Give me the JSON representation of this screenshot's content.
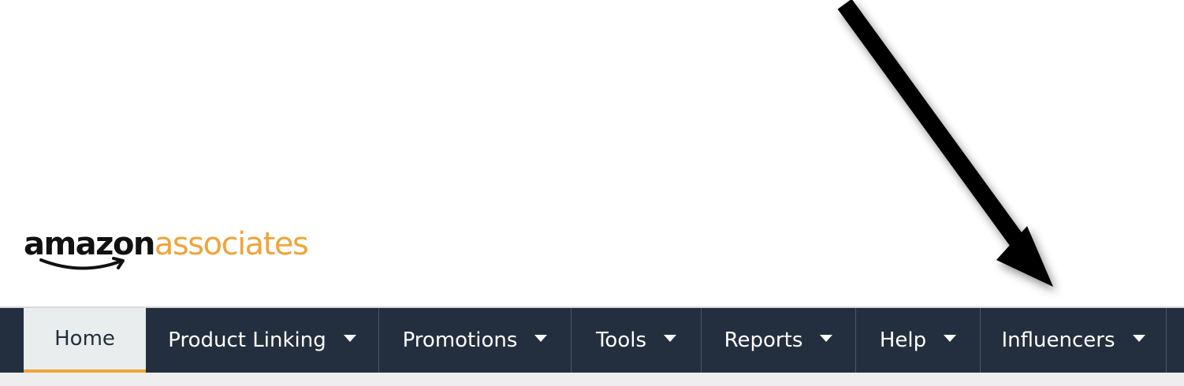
{
  "logo": {
    "amazon": "amazon",
    "associates": "associates",
    "colors": {
      "amazon": "#111111",
      "associates": "#f0a43a"
    }
  },
  "annotation": {
    "icon": "arrow-down-right-icon",
    "color": "#000000"
  },
  "nav": {
    "background": "#232f3e",
    "active_color": "#eaeded",
    "accent": "#f0a43a",
    "items": [
      {
        "label": "Home",
        "active": true
      },
      {
        "label": "Product Linking",
        "dropdown": true
      },
      {
        "label": "Promotions",
        "dropdown": true
      },
      {
        "label": "Tools",
        "dropdown": true
      },
      {
        "label": "Reports",
        "dropdown": true
      },
      {
        "label": "Help",
        "dropdown": true
      },
      {
        "label": "Influencers",
        "dropdown": true
      }
    ]
  }
}
